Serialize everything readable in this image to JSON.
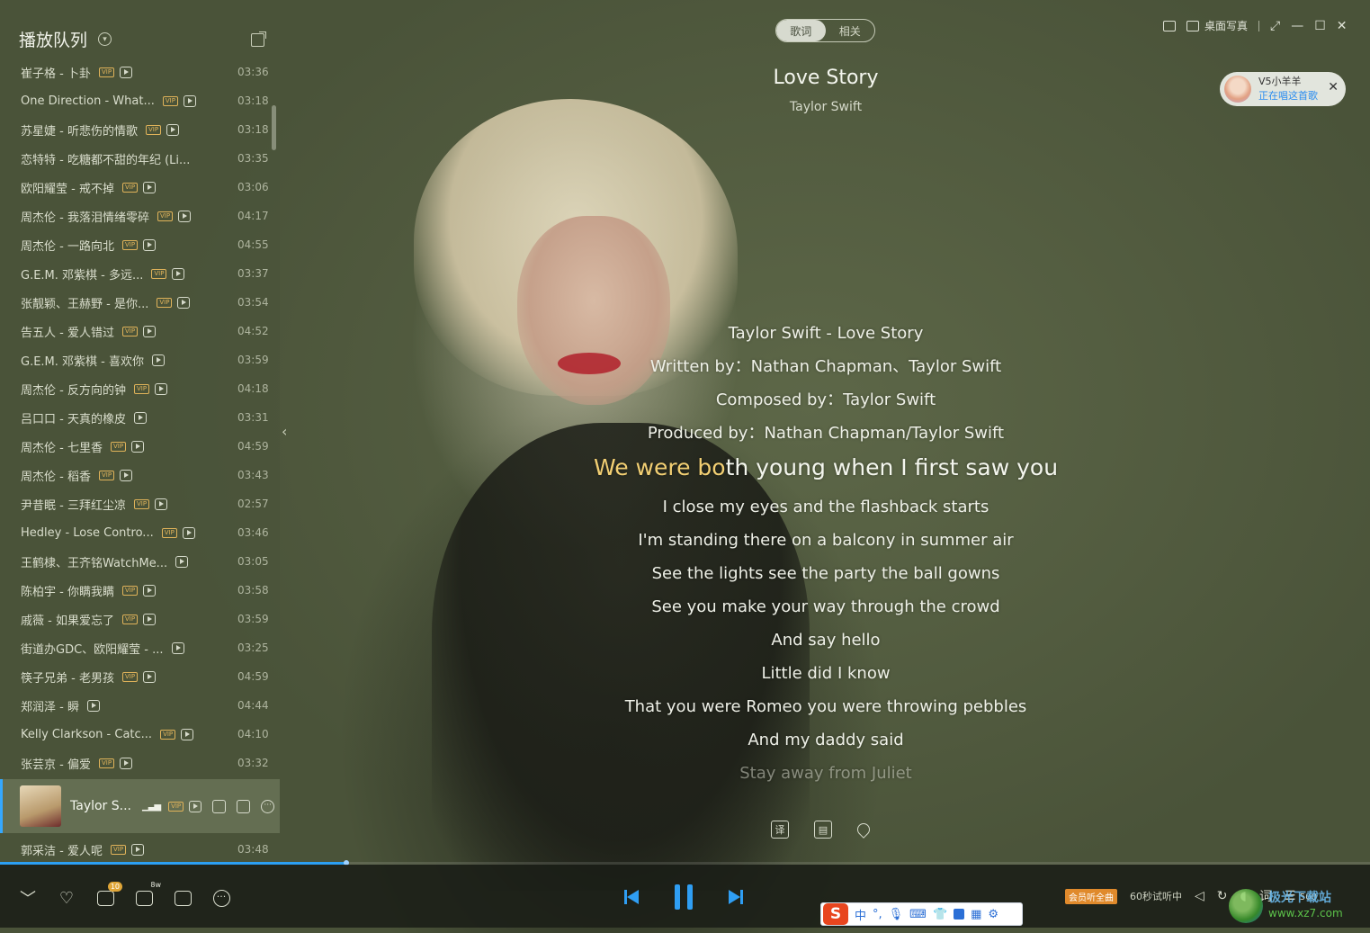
{
  "sidebar": {
    "title": "播放队列",
    "tracks": [
      {
        "name": "崔子格 - 卜卦",
        "vip": true,
        "mv": true,
        "duration": "03:36"
      },
      {
        "name": "One Direction - What...",
        "vip": true,
        "mv": true,
        "duration": "03:18"
      },
      {
        "name": "苏星婕 - 听悲伤的情歌",
        "vip": true,
        "mv": true,
        "duration": "03:18"
      },
      {
        "name": "恋特特 - 吃糖都不甜的年纪 (Li...",
        "vip": false,
        "mv": false,
        "duration": "03:35"
      },
      {
        "name": "欧阳耀莹 - 戒不掉",
        "vip": true,
        "mv": true,
        "duration": "03:06"
      },
      {
        "name": "周杰伦 - 我落泪情绪零碎",
        "vip": true,
        "mv": true,
        "duration": "04:17"
      },
      {
        "name": "周杰伦 - 一路向北",
        "vip": true,
        "mv": true,
        "duration": "04:55"
      },
      {
        "name": "G.E.M. 邓紫棋 - 多远...",
        "vip": true,
        "mv": true,
        "duration": "03:37"
      },
      {
        "name": "张靓颖、王赫野 - 是你...",
        "vip": true,
        "mv": true,
        "duration": "03:54"
      },
      {
        "name": "告五人 - 爱人错过",
        "vip": true,
        "mv": true,
        "duration": "04:52"
      },
      {
        "name": "G.E.M. 邓紫棋 - 喜欢你",
        "vip": false,
        "mv": true,
        "duration": "03:59"
      },
      {
        "name": "周杰伦 - 反方向的钟",
        "vip": true,
        "mv": true,
        "duration": "04:18"
      },
      {
        "name": "吕口口 - 天真的橡皮",
        "vip": false,
        "mv": true,
        "duration": "03:31"
      },
      {
        "name": "周杰伦 - 七里香",
        "vip": true,
        "mv": true,
        "duration": "04:59"
      },
      {
        "name": "周杰伦 - 稻香",
        "vip": true,
        "mv": true,
        "duration": "03:43"
      },
      {
        "name": "尹昔眠 - 三拜红尘凉",
        "vip": true,
        "mv": true,
        "duration": "02:57"
      },
      {
        "name": "Hedley - Lose Contro...",
        "vip": true,
        "mv": true,
        "duration": "03:46"
      },
      {
        "name": "王鹤棣、王齐铭WatchMe...",
        "vip": false,
        "mv": true,
        "duration": "03:05"
      },
      {
        "name": "陈柏宇 - 你瞒我瞒",
        "vip": true,
        "mv": true,
        "duration": "03:58"
      },
      {
        "name": "戚薇 - 如果爱忘了",
        "vip": true,
        "mv": true,
        "duration": "03:59"
      },
      {
        "name": "街道办GDC、欧阳耀莹 - ...",
        "vip": false,
        "mv": true,
        "duration": "03:25"
      },
      {
        "name": "筷子兄弟 - 老男孩",
        "vip": true,
        "mv": true,
        "duration": "04:59"
      },
      {
        "name": "郑润泽 - 瞬",
        "vip": false,
        "mv": true,
        "duration": "04:44"
      },
      {
        "name": "Kelly Clarkson - Catc...",
        "vip": true,
        "mv": true,
        "duration": "04:10"
      },
      {
        "name": "张芸京 - 偏爱",
        "vip": true,
        "mv": true,
        "duration": "03:32"
      }
    ],
    "current": {
      "name": "Taylor S...",
      "vip": true
    },
    "after": {
      "name": "郭采洁 - 爱人呢",
      "vip": true,
      "mv": true,
      "duration": "03:48"
    }
  },
  "tabs": {
    "lyrics": "歌词",
    "related": "相关"
  },
  "song": {
    "title": "Love Story",
    "artist": "Taylor Swift"
  },
  "window": {
    "desktop_label": "桌面写真"
  },
  "live": {
    "name": "V5小羊羊",
    "status": "正在唱这首歌"
  },
  "lyrics": {
    "lines_before": [
      "Taylor Swift - Love Story",
      "Written by：Nathan Chapman、Taylor Swift",
      "Composed by：Taylor Swift",
      "Produced by：Nathan Chapman/Taylor Swift"
    ],
    "active_sung": "We were bo",
    "active_rest": "th young when I first saw you",
    "lines_after": [
      "I close my eyes and the flashback starts",
      "I'm standing there on a balcony in summer air",
      "See the lights see the party the ball gowns",
      "See you make your way through the crowd",
      "And say hello",
      "Little did I know",
      "That you were Romeo you were throwing pebbles",
      "And my daddy said"
    ],
    "faded_line": "Stay away from Juliet",
    "translate_label": "译"
  },
  "progress": {
    "fraction": 0.253
  },
  "bottom": {
    "download_count": "10",
    "comment_count": "8w",
    "member_label": "会员听全曲",
    "trial_label": "60秒试听中",
    "lyric_label": "词",
    "queue_count": "500"
  },
  "ime": {
    "logo": "S",
    "mode": "中",
    "punct": "°,"
  },
  "watermark": {
    "site": "极光下载站",
    "url": "www.xz7.com"
  },
  "colors": {
    "accent": "#2f9ef3",
    "highlight_lyric": "#f2cf73",
    "vip": "#e0b35a"
  }
}
